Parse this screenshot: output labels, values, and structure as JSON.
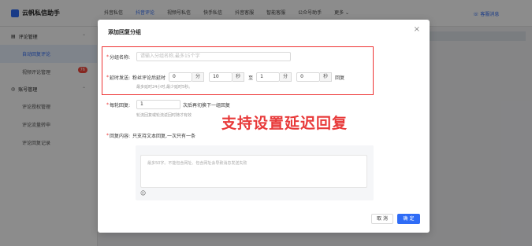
{
  "app": {
    "brand": "云帆私信助手",
    "nav": [
      "抖音私信",
      "抖音评论",
      "视频号私信",
      "快手私信",
      "抖音客服",
      "智能客服",
      "公众号助手",
      "更多"
    ],
    "active_nav": 1,
    "service": "客服消息"
  },
  "sidebar": {
    "group1": "评论管理",
    "items1": [
      {
        "label": "自动回复评论",
        "active": true
      },
      {
        "label": "视频评论管理",
        "badge": "76"
      }
    ],
    "group2": "账号管理",
    "items2": [
      {
        "label": "评论授权管理"
      },
      {
        "label": "评论流量转申"
      },
      {
        "label": "评论回复记录"
      }
    ]
  },
  "modal": {
    "title": "添加回复分组",
    "close": "×",
    "name_label": "分组名称:",
    "name_placeholder": "请输入分组名称,最多15个字",
    "delay_label": "延时发送:",
    "delay_prefix": "粉丝评论后延时",
    "delay_from_value": "0",
    "delay_from_unit1": "分",
    "delay_from_sec": "10",
    "delay_from_unit2": "秒",
    "delay_to_word": "至",
    "delay_to_value": "1",
    "delay_to_unit1": "分",
    "delay_to_sec": "0",
    "delay_to_unit2": "秒",
    "delay_suffix": "回复",
    "delay_hint": "最多延时24小时,最少延时5秒。",
    "rounds_label": "每轮回复:",
    "rounds_value": "1",
    "rounds_suffix": "次后再切换下一组回复",
    "rounds_hint": "轮流回复或轮流返回时随才有效",
    "content_label": "回复内容:",
    "content_note": "只支持文本回复,一次只有一条",
    "content_placeholder": "最多50字。不能包含网址、包含网址会导致消息发送失败",
    "emoji_icon": "☺",
    "cancel_button": "取 消",
    "ok_button": "确 定"
  },
  "annotation": "支持设置延迟回复"
}
